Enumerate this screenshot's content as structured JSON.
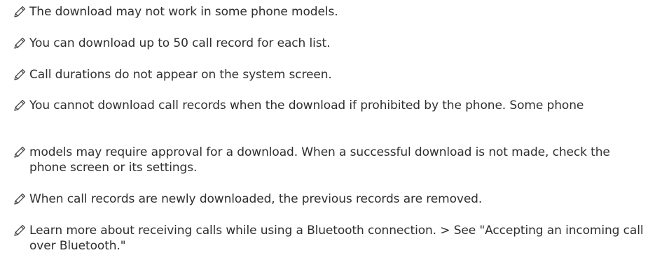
{
  "notes": [
    {
      "icon": "pencil-icon",
      "text": "The download may not work in some phone models."
    },
    {
      "icon": "pencil-icon",
      "text": "You can download up to 50 call record for each list."
    },
    {
      "icon": "pencil-icon",
      "text": "Call durations do not appear on the system screen."
    },
    {
      "icon": "pencil-icon",
      "text": "You cannot download call records when the download if prohibited by the phone. Some phone"
    },
    {
      "icon": "pencil-icon",
      "text": "models may require approval for a download. When a successful download is not made, check the phone screen or its settings."
    },
    {
      "icon": "pencil-icon",
      "text": "When call records are newly downloaded, the previous records are removed."
    },
    {
      "icon": "pencil-icon",
      "text": "Learn more about receiving calls while using a Bluetooth connection. > See \"Accepting an incoming call over Bluetooth.\""
    }
  ],
  "colors": {
    "text": "#2f2f2f",
    "icon": "#444444"
  }
}
